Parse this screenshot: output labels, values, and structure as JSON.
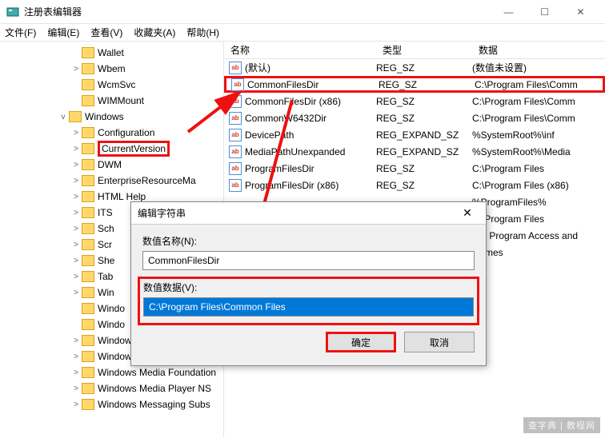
{
  "window": {
    "title": "注册表编辑器",
    "min": "—",
    "max": "☐",
    "close": "✕"
  },
  "menu": [
    "文件(F)",
    "编辑(E)",
    "查看(V)",
    "收藏夹(A)",
    "帮助(H)"
  ],
  "tree": [
    {
      "indent": 88,
      "twisty": "",
      "label": "Wallet"
    },
    {
      "indent": 88,
      "twisty": ">",
      "label": "Wbem"
    },
    {
      "indent": 88,
      "twisty": "",
      "label": "WcmSvc"
    },
    {
      "indent": 88,
      "twisty": "",
      "label": "WIMMount"
    },
    {
      "indent": 72,
      "twisty": "v",
      "label": "Windows"
    },
    {
      "indent": 88,
      "twisty": ">",
      "label": "Configuration"
    },
    {
      "indent": 88,
      "twisty": ">",
      "label": "CurrentVersion",
      "hl": true
    },
    {
      "indent": 88,
      "twisty": ">",
      "label": "DWM"
    },
    {
      "indent": 88,
      "twisty": ">",
      "label": "EnterpriseResourceMa"
    },
    {
      "indent": 88,
      "twisty": ">",
      "label": "HTML Help"
    },
    {
      "indent": 88,
      "twisty": ">",
      "label": "ITS"
    },
    {
      "indent": 88,
      "twisty": ">",
      "label": "Sch"
    },
    {
      "indent": 88,
      "twisty": ">",
      "label": "Scr"
    },
    {
      "indent": 88,
      "twisty": ">",
      "label": "She"
    },
    {
      "indent": 88,
      "twisty": ">",
      "label": "Tab"
    },
    {
      "indent": 88,
      "twisty": ">",
      "label": "Win"
    },
    {
      "indent": 88,
      "twisty": "",
      "label": "Windo"
    },
    {
      "indent": 88,
      "twisty": "",
      "label": "Windo"
    },
    {
      "indent": 88,
      "twisty": ">",
      "label": "Windows Mail"
    },
    {
      "indent": 88,
      "twisty": ">",
      "label": "Windows Media Device M"
    },
    {
      "indent": 88,
      "twisty": ">",
      "label": "Windows Media Foundation"
    },
    {
      "indent": 88,
      "twisty": ">",
      "label": "Windows Media Player NS"
    },
    {
      "indent": 88,
      "twisty": ">",
      "label": "Windows Messaging Subs"
    }
  ],
  "columns": {
    "name": "名称",
    "type": "类型",
    "data": "数据"
  },
  "rows": [
    {
      "icon": "ab",
      "name": "(默认)",
      "type": "REG_SZ",
      "data": "(数值未设置)"
    },
    {
      "icon": "ab",
      "name": "CommonFilesDir",
      "type": "REG_SZ",
      "data": "C:\\Program Files\\Comm",
      "hl": true
    },
    {
      "icon": "ab",
      "name": "CommonFilesDir (x86)",
      "type": "REG_SZ",
      "data": "C:\\Program Files\\Comm"
    },
    {
      "icon": "ab",
      "name": "CommonW6432Dir",
      "type": "REG_SZ",
      "data": "C:\\Program Files\\Comm"
    },
    {
      "icon": "ab",
      "name": "DevicePath",
      "type": "REG_EXPAND_SZ",
      "data": "%SystemRoot%\\inf"
    },
    {
      "icon": "ab",
      "name": "MediaPathUnexpanded",
      "type": "REG_EXPAND_SZ",
      "data": "%SystemRoot%\\Media"
    },
    {
      "icon": "ab",
      "name": "ProgramFilesDir",
      "type": "REG_SZ",
      "data": "C:\\Program Files"
    },
    {
      "icon": "ab",
      "name": "ProgramFilesDir (x86)",
      "type": "REG_SZ",
      "data": "C:\\Program Files (x86)"
    },
    {
      "icon": "",
      "name": "",
      "type": "",
      "data": "%ProgramFiles%"
    },
    {
      "icon": "",
      "name": "",
      "type": "",
      "data": "C:\\Program Files"
    },
    {
      "icon": "",
      "name": "",
      "type": "",
      "data": "Set Program Access and"
    },
    {
      "icon": "",
      "name": "",
      "type": "",
      "data": "Games"
    }
  ],
  "dialog": {
    "title": "编辑字符串",
    "name_label": "数值名称(N):",
    "name_value": "CommonFilesDir",
    "data_label": "数值数据(V):",
    "data_value": "C:\\Program Files\\Common Files",
    "ok": "确定",
    "cancel": "取消"
  },
  "watermark": "查字典 | 教程网"
}
